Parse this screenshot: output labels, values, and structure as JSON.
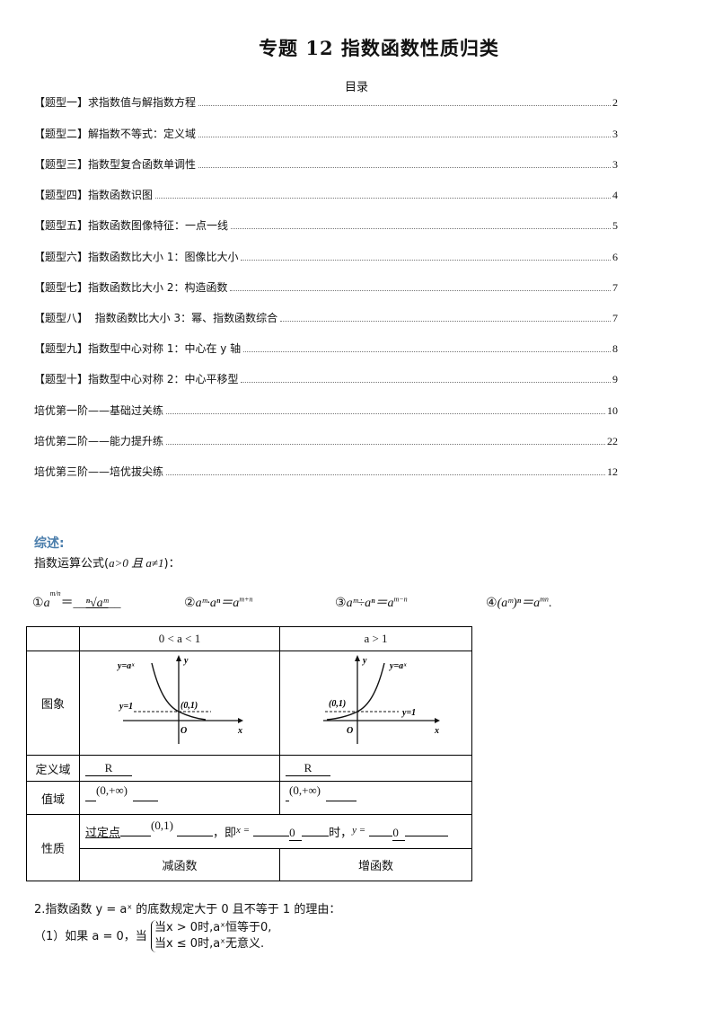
{
  "document": {
    "title": "专题 12  指数函数性质归类",
    "toc_heading": "目录"
  },
  "toc": [
    {
      "label": "【题型一】求指数值与解指数方程",
      "page": "2"
    },
    {
      "label": "【题型二】解指数不等式：定义域",
      "page": "3"
    },
    {
      "label": "【题型三】指数型复合函数单调性",
      "page": "3"
    },
    {
      "label": "【题型四】指数函数识图",
      "page": "4"
    },
    {
      "label": "【题型五】指数函数图像特征：一点一线",
      "page": "5"
    },
    {
      "label": "【题型六】指数函数比大小 1：图像比大小",
      "page": "6"
    },
    {
      "label": "【题型七】指数函数比大小 2：构造函数",
      "page": "7"
    },
    {
      "label": "【题型八】  指数函数比大小 3：幂、指数函数综合",
      "page": "7"
    },
    {
      "label": "【题型九】指数型中心对称 1：中心在 y 轴",
      "page": "8"
    },
    {
      "label": "【题型十】指数型中心对称 2：中心平移型",
      "page": "9"
    },
    {
      "label": "培优第一阶——基础过关练",
      "page": "10"
    },
    {
      "label": "培优第二阶——能力提升练",
      "page": "22"
    },
    {
      "label": "培优第三阶——培优拔尖练",
      "page": "12"
    }
  ],
  "summary": {
    "heading": "综述:",
    "intro_prefix": "指数运算公式(",
    "intro_cond": "a>0 且 a≠1",
    "intro_suffix": ")：",
    "accent_color": "#4a7dab",
    "formulas": [
      {
        "num": "①",
        "lhs": "a",
        "exp": "m/n",
        "eq": "＝__",
        "rhs": "ⁿ√aᵐ",
        "tail": "__"
      },
      {
        "num": "②",
        "text": "aᵐ·aⁿ＝a",
        "exp": "m+n"
      },
      {
        "num": "③",
        "text": "aᵐ÷aⁿ＝a",
        "exp": "m−n"
      },
      {
        "num": "④",
        "text": "(aᵐ)ⁿ＝a",
        "exp": "mn",
        "tail": "."
      }
    ]
  },
  "table": {
    "headers": [
      "",
      "0 < a < 1",
      "a > 1"
    ],
    "rows": {
      "graph_label": "图象",
      "domain_label": "定义域",
      "domain_left": "R",
      "domain_right": "R",
      "range_label": "值域",
      "range_left": "(0,+∞)",
      "range_right": "(0,+∞)",
      "property_label": "性质",
      "fixed_point_prefix": "过定点",
      "fixed_point": "(0,1)",
      "fixed_point_mid": "，即",
      "x_eq": "x =",
      "x_value": "0",
      "when": "时，",
      "y_eq": "y =",
      "y_value": "0",
      "mono_left": "减函数",
      "mono_right": "增函数"
    },
    "graph_left": {
      "curve_label": "y=aˣ",
      "asymptote_label": "y=1",
      "point_label": "(0,1)",
      "origin": "O",
      "x_axis": "x",
      "y_axis": "y"
    },
    "graph_right": {
      "curve_label": "y=aˣ",
      "asymptote_label": "y=1",
      "point_label": "(0,1)",
      "origin": "O",
      "x_axis": "x",
      "y_axis": "y"
    }
  },
  "reason": {
    "line1": "2.指数函数 y = aˣ 的底数规定大于 0 且不等于 1 的理由：",
    "line2_prefix": "（1）如果 a = 0，当",
    "case1": "当x > 0时,aˣ恒等于0,",
    "case2": "当x ≤ 0时,aˣ无意义."
  }
}
